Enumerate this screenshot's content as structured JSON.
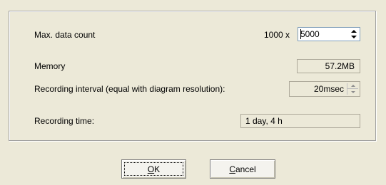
{
  "settings": {
    "max_data_count": {
      "label": "Max. data count",
      "multiplier": "1000 x",
      "value": "5000"
    },
    "memory": {
      "label": "Memory",
      "value": "57.2MB"
    },
    "recording_interval": {
      "label": "Recording interval (equal with diagram resolution):",
      "value": "20msec"
    },
    "recording_time": {
      "label": "Recording time:",
      "value": "1 day, 4 h"
    }
  },
  "buttons": {
    "ok": {
      "accel": "O",
      "rest": "K"
    },
    "cancel": {
      "accel": "C",
      "rest": "ancel"
    }
  },
  "icons": [
    "spin-up-arrow-icon",
    "spin-down-arrow-icon"
  ]
}
